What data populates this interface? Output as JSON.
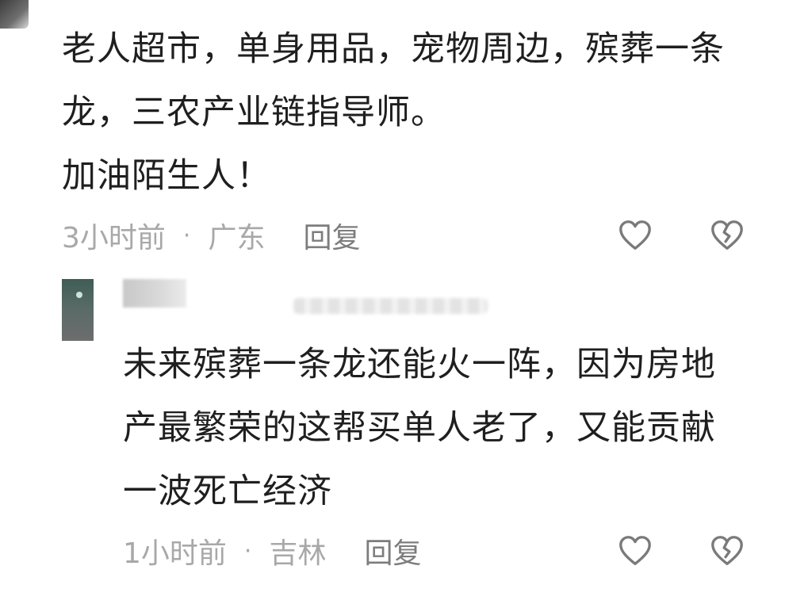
{
  "comment": {
    "lines": [
      "老人超市，单身用品，宠物周边，殡葬一条",
      "龙，三农产业链指导师。",
      "加油陌生人！"
    ],
    "time": "3小时前",
    "separator": "·",
    "location": "广东",
    "reply_label": "回复",
    "like_icon": "heart-outline-icon",
    "dislike_icon": "broken-heart-icon"
  },
  "reply": {
    "lines": [
      "未来殡葬一条龙还能火一阵，因为房地",
      "产最繁荣的这帮买单人老了，又能贡献",
      "一波死亡经济"
    ],
    "time": "1小时前",
    "separator": "·",
    "location": "吉林",
    "reply_label": "回复",
    "like_icon": "heart-outline-icon",
    "dislike_icon": "broken-heart-icon"
  },
  "colors": {
    "text": "#1f1f1f",
    "meta": "#a8a8a8",
    "reply_link": "#7d7d7d",
    "icon": "#7a7a7a"
  }
}
